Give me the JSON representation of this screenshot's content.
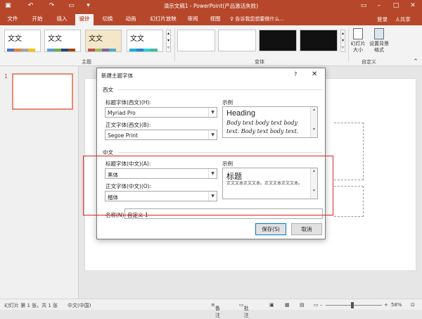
{
  "titlebar": {
    "title": "演示文稿1 - PowerPoint(产品激活失败)",
    "icons": [
      "save-icon",
      "undo-icon",
      "redo-icon",
      "present-icon",
      "customize-icon"
    ],
    "window_controls": [
      "ribbon-display-icon",
      "minimize-icon",
      "maximize-icon",
      "close-icon"
    ]
  },
  "menu": {
    "tabs": [
      "文件",
      "开始",
      "插入",
      "设计",
      "切换",
      "动画",
      "幻灯片放映",
      "审阅",
      "视图"
    ],
    "active_tab": "设计",
    "tell_me": "告诉我您想要做什么...",
    "login": "登录",
    "share": "共享"
  },
  "ribbon": {
    "themes_group": "主题",
    "variants_group": "变体",
    "customize_group": "自定义",
    "theme_sample_text": "文文",
    "slide_size": "幻灯片大小",
    "format_background": "设置背景格式"
  },
  "status": {
    "slide_info": "幻灯片 第 1 张，共 1 张",
    "language": "中文(中国)",
    "notes": "备注",
    "comments": "批注",
    "zoom": "58%"
  },
  "dialog": {
    "title": "新建主题字体",
    "help": "?",
    "close": "✕",
    "western": {
      "section": "西文",
      "heading_label": "标题字体(西文)(H):",
      "heading_value": "Myriad Pro",
      "body_label": "正文字体(西文)(B):",
      "body_value": "Segoe Print",
      "sample_label": "示例",
      "sample_heading": "Heading",
      "sample_body": "Body text body text body text. Body text body text."
    },
    "chinese": {
      "section": "中文",
      "heading_label": "标题字体(中文)(A):",
      "heading_value": "黑体",
      "body_label": "正文字体(中文)(O):",
      "body_value": "楷体",
      "sample_label": "示例",
      "sample_heading": "标题",
      "sample_body": "正文文本正文文本。正文文本正文文本。"
    },
    "name_label": "名称(N):",
    "name_value": "自定义 1",
    "save": "保存(S)",
    "cancel": "取消"
  },
  "colors": {
    "accent": "#b7472a",
    "highlight_box": "#e02020"
  }
}
